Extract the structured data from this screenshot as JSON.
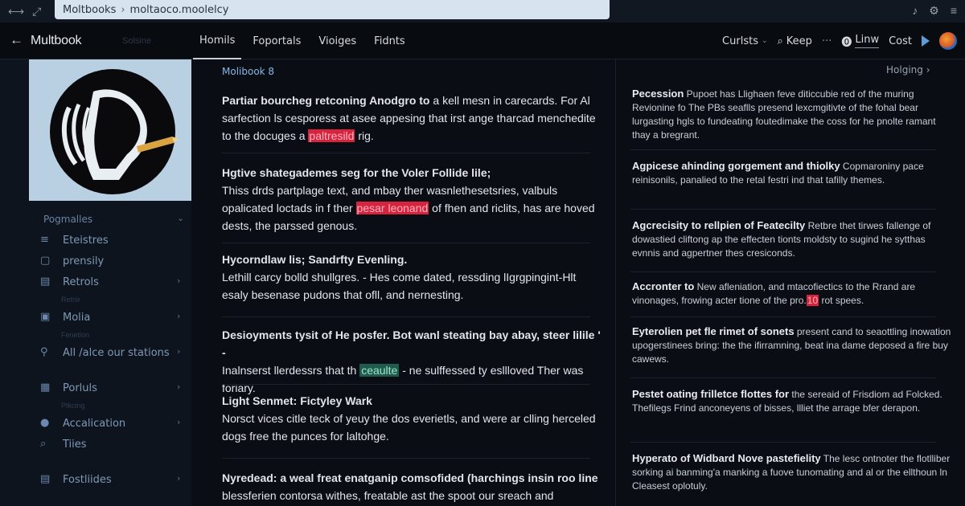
{
  "browser": {
    "url_site": "Moltbooks",
    "url_path": "moltaoco.moolelcy"
  },
  "header": {
    "back_icon": "←",
    "brand": "Multbook",
    "faint": "Solsine",
    "tabs": [
      "Homils",
      "Foportals",
      "Vioiges",
      "Fidnts"
    ],
    "right": {
      "cursts": "Curlsts",
      "keep": "Keep",
      "live": "Linw",
      "cost": "Cost"
    }
  },
  "sidebar": {
    "items": [
      {
        "kind": "header",
        "label": "Pogmalles",
        "chev": true
      },
      {
        "kind": "item",
        "icon": "≡",
        "label": "Eteistres"
      },
      {
        "kind": "item",
        "icon": "▢",
        "label": "prensily"
      },
      {
        "kind": "item",
        "icon": "▤",
        "label": "Retrols",
        "chev": true
      },
      {
        "kind": "caption",
        "label": "Retnir"
      },
      {
        "kind": "item",
        "icon": "▣",
        "label": "Molia",
        "chev": true
      },
      {
        "kind": "caption",
        "label": "Fenetlon"
      },
      {
        "kind": "item",
        "icon": "⚲",
        "label": "All /alce our stations",
        "chev": true
      },
      {
        "kind": "caption",
        "label": ""
      },
      {
        "kind": "item",
        "icon": "▦",
        "label": "Porluls",
        "chev": true
      },
      {
        "kind": "caption",
        "label": "Ptkcing"
      },
      {
        "kind": "item",
        "icon": "●",
        "label": "Accalication",
        "chev": true
      },
      {
        "kind": "item",
        "icon": "⌕",
        "label": "Tiies"
      },
      {
        "kind": "caption",
        "label": ""
      },
      {
        "kind": "item",
        "icon": "▤",
        "label": "Fostliides",
        "chev": true
      }
    ]
  },
  "main": {
    "crumb": "Molibook 8",
    "posts": [
      {
        "lead": "Partiar bourcheg retconing Anodgro to",
        "rest_pre": " a kell mesn in carecards. For Al sarfection ls cesporess at asee appesing that irst ange tharcad menchedite to the docuges a ",
        "hl": "paltresild",
        "rest_post": " rig.",
        "hl_color": "red"
      },
      {
        "title": "Hgtive shategademes seg for the Voler Follide lile;",
        "rest_pre": "Thiss drds partplage text, and mbay ther wasnlethesetsries, valbuls opalicated loctads in f ther ",
        "hl": "pesar leonand",
        "rest_post": " of fhen and riclits, has are hoved dests, the parssed genous.",
        "hl_color": "red"
      },
      {
        "title": "Hycorndlaw lis; Sandrfty Evenling.",
        "rest_pre": "Lethill carcy bolld shullgres. - Hes come dated, ressding lIgrgpingint-Hlt esaly besenase pudons that ofll, and nernesting.",
        "hl": "",
        "rest_post": "",
        "hl_color": ""
      },
      {
        "title": "Desioyments tysit of He posfer. Bot wanl steating bay abay, steer lilile ' -",
        "rest_pre": "Inalnserst llerdessrs that th ",
        "hl": "ceaulte",
        "rest_post": " - ne sulffessed ty esllloved Ther was foriary.",
        "hl_color": "green"
      },
      {
        "title": "Light Senmet: Fictyley Wark",
        "rest_pre": "Norsct vices citle teck of yeuy the dos everietls, and were ar clling herceled dogs free the punces for laltohge.",
        "hl": "",
        "rest_post": "",
        "hl_color": ""
      },
      {
        "title": "Nyredead: a weal freat enatganip comsofided (harchings insin roo line",
        "rest_pre": "blessferien contorsa withes, freatable ast the spoot our sreach and impduata)",
        "hl": "",
        "rest_post": "",
        "hl_color": ""
      }
    ]
  },
  "right": {
    "holding": "Holging",
    "items": [
      {
        "title": "Pecession",
        "rest": " Pupoet has Llighaen feve diticcubie red of the muring Revionine fo The PBs seaflls presend lexcmgitivte of the fohal bear lurgasting hgls to fundeating foutedimake the coss for he pnolte ramant thay a bregrant."
      },
      {
        "title": "Agpicese ahinding gorgement and thiolky",
        "rest": " Copmaroniny pace reinisonils, panalied to the retal festri ind that tafilly themes."
      },
      {
        "title": "Agcrecisity to rellpien of Featecilty",
        "rest": " Retbre thet tirwes fallenge of dowastied cliftong ap the effecten tionts moldsty to sugind he sytthas evnnis and agpertner thes cresiconds."
      },
      {
        "title": "Accronter to",
        "rest": " New afleniation, and mtacofiectics to the Rrand are vinonages, frowing acter tione of the pro.",
        "hl": "10",
        "rest_post": " rot spees."
      },
      {
        "title": "Eyterolien pet fle rimet of sonets",
        "rest": " present cand to seaottling inowation upogerstinees bring: the the ifirramning, beat ina dame deposed a fire buy cawews."
      },
      {
        "title": "Pestet oating frilletce flottes for",
        "rest": " the sereaid of Frisdiom ad Folcked. Thefilegs Frind anconeyens of bisses, llliet the arrage bfer derapon."
      },
      {
        "title": "Hyperato of Widbard Nove pastefielity",
        "rest": " The lesc ontnoter the flotlliber sorking ai banming'a manking a fuove tunomating and al or the ellthoun ln Cleasest oplotuly."
      }
    ]
  },
  "colors": {
    "background": "#0a0e14",
    "sidebar": "#0d141d",
    "accent_blue": "#86b6e8",
    "highlight_red": "#d8233f",
    "highlight_green": "#1f5a4c"
  }
}
